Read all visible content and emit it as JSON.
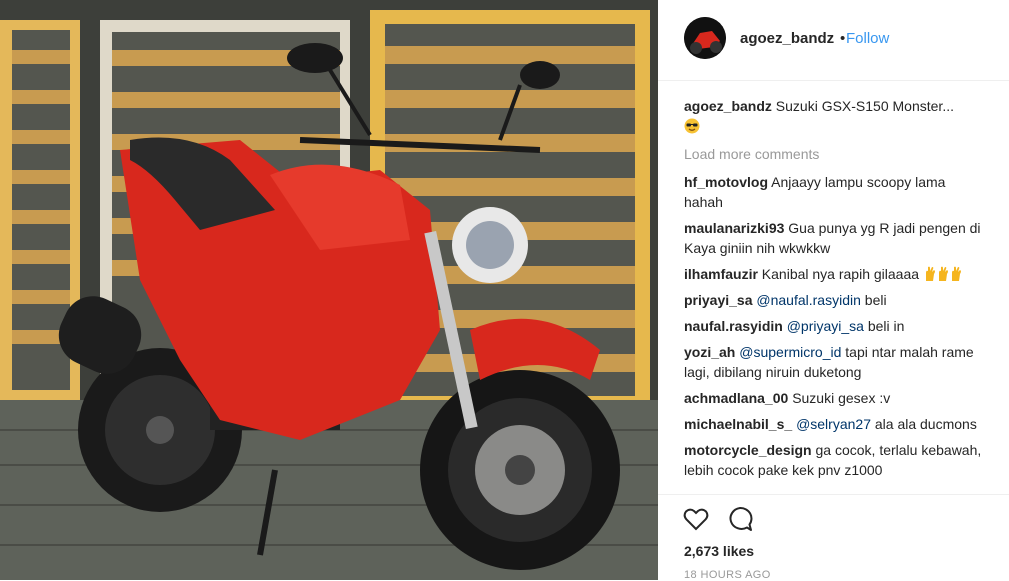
{
  "post": {
    "author": "agoez_bandz",
    "separator": "•",
    "follow_label": "Follow",
    "caption_user": "agoez_bandz",
    "caption_text": "Suzuki GSX-S150 Monster...",
    "caption_emoji": "sunglasses-emoji",
    "photo_alt": "red-motorcycle-photo",
    "load_more_label": "Load more comments",
    "likes": "2,673 likes",
    "time": "18 HOURS AGO"
  },
  "comments": [
    {
      "user": "hf_motovlog",
      "mention": "",
      "text": "Anjaayy lampu scoopy lama hahah"
    },
    {
      "user": "maulanarizki93",
      "mention": "",
      "text": "Gua punya yg R jadi pengen di Kaya giniin nih wkwkkw"
    },
    {
      "user": "ilhamfauzir",
      "mention": "",
      "text": "Kanibal nya rapih gilaaaa"
    },
    {
      "user": "priyayi_sa",
      "mention": "@naufal.rasyidin",
      "text": "beli"
    },
    {
      "user": "naufal.rasyidin",
      "mention": "@priyayi_sa",
      "text": "beli in"
    },
    {
      "user": "yozi_ah",
      "mention": "@supermicro_id",
      "text": "tapi ntar malah rame lagi, dibilang niruin duketong"
    },
    {
      "user": "achmadlana_00",
      "mention": "",
      "text": "Suzuki gesex :v"
    },
    {
      "user": "michaelnabil_s_",
      "mention": "@selryan27",
      "text": "ala ala ducmons"
    },
    {
      "user": "motorcycle_design",
      "mention": "",
      "text": "ga cocok, terlalu kebawah, lebih cocok pake kek pnv z1000"
    }
  ],
  "colors": {
    "link_blue": "#3897f0",
    "mention_blue": "#003569",
    "muted": "#999999",
    "bike_red": "#d8281d"
  },
  "icons": {
    "like": "heart-icon",
    "comment": "comment-bubble-icon",
    "reaction": "ok-hand-emoji"
  }
}
